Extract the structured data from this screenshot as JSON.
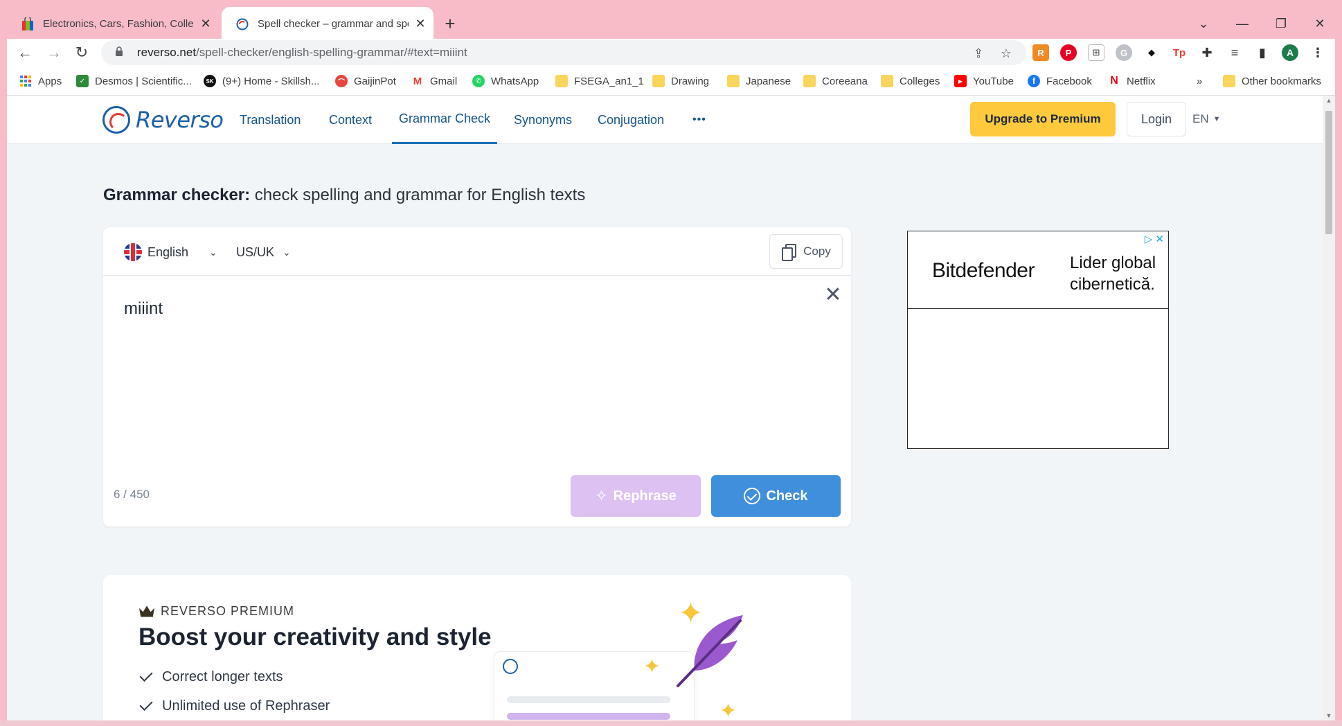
{
  "browser": {
    "tabs": [
      {
        "title": "Electronics, Cars, Fashion, Collectibles",
        "active": false
      },
      {
        "title": "Spell checker – grammar and spelling",
        "active": true
      }
    ],
    "url_host": "reverso.net",
    "url_path": "/spell-checker/english-spelling-grammar/#text=miiint",
    "profile_initial": "A",
    "bookmarks": [
      {
        "label": "Apps",
        "icon": "apps-grid-icon"
      },
      {
        "label": "Desmos | Scientific...",
        "icon": "desmos-icon"
      },
      {
        "label": "(9+) Home - Skillsh...",
        "icon": "skillshare-icon"
      },
      {
        "label": "GaijinPot",
        "icon": "gaijinpot-icon"
      },
      {
        "label": "Gmail",
        "icon": "gmail-icon"
      },
      {
        "label": "WhatsApp",
        "icon": "whatsapp-icon"
      },
      {
        "label": "FSEGA_an1_1",
        "icon": "folder-icon"
      },
      {
        "label": "Drawing",
        "icon": "folder-icon"
      },
      {
        "label": "Japanese",
        "icon": "folder-icon"
      },
      {
        "label": "Coreeana",
        "icon": "folder-icon"
      },
      {
        "label": "Colleges",
        "icon": "folder-icon"
      },
      {
        "label": "YouTube",
        "icon": "youtube-icon"
      },
      {
        "label": "Facebook",
        "icon": "facebook-icon"
      },
      {
        "label": "Netflix",
        "icon": "netflix-icon"
      }
    ],
    "bookmarks_overflow": "»",
    "other_bookmarks": "Other bookmarks"
  },
  "site": {
    "logo_text": "Reverso",
    "nav": [
      "Translation",
      "Context",
      "Grammar Check",
      "Synonyms",
      "Conjugation"
    ],
    "nav_more": "•••",
    "active_nav": "Grammar Check",
    "upgrade_label": "Upgrade to Premium",
    "login_label": "Login",
    "lang_label": "EN"
  },
  "main": {
    "heading_bold": "Grammar checker:",
    "heading_rest": " check spelling and grammar for English texts",
    "editor": {
      "language": "English",
      "variant": "US/UK",
      "copy_label": "Copy",
      "text": "miiint",
      "counter": "6 / 450",
      "rephrase_label": "Rephrase",
      "check_label": "Check"
    }
  },
  "ad": {
    "brand": "Bitdefender",
    "tagline_line1": "Lider global",
    "tagline_line2": "cibernetică."
  },
  "premium": {
    "label": "REVERSO PREMIUM",
    "title": "Boost your creativity and style",
    "features": [
      "Correct longer texts",
      "Unlimited use of Rephraser"
    ]
  },
  "colors": {
    "tabstrip": "#f8bcc9",
    "brand_blue": "#1d5fa6",
    "check_blue": "#3f8fdc",
    "rephrase_purple": "#dcc1f2",
    "upgrade_yellow": "#ffc93d"
  }
}
